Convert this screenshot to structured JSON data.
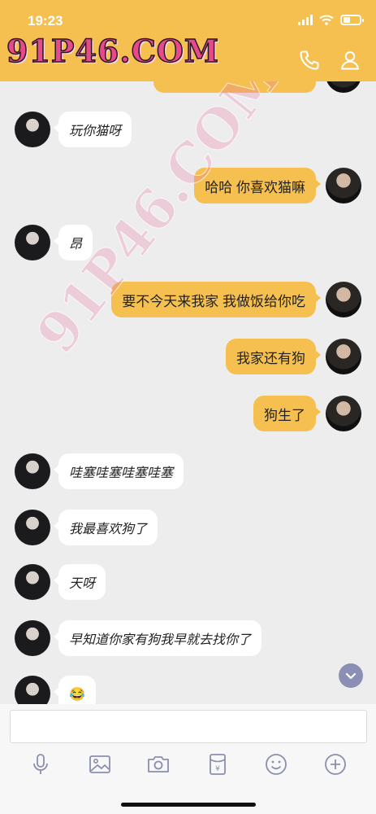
{
  "status": {
    "time": "19:23"
  },
  "header": {
    "brand": "91P46.COM"
  },
  "watermark": "91P46.COM",
  "messages": [
    {
      "side": "her",
      "text": "玩你猫呀"
    },
    {
      "side": "me",
      "text": "哈哈 你喜欢猫嘛"
    },
    {
      "side": "her",
      "text": "昂"
    },
    {
      "side": "me",
      "text": "要不今天来我家 我做饭给你吃"
    },
    {
      "side": "me",
      "text": "我家还有狗"
    },
    {
      "side": "me",
      "text": "狗生了"
    },
    {
      "side": "her",
      "text": "哇塞哇塞哇塞哇塞"
    },
    {
      "side": "her",
      "text": "我最喜欢狗了"
    },
    {
      "side": "her",
      "text": "天呀"
    },
    {
      "side": "her",
      "text": "早知道你家有狗我早就去找你了"
    },
    {
      "side": "her",
      "text": "😂"
    }
  ],
  "composer": {
    "value": "",
    "placeholder": ""
  },
  "toolbar": [
    "mic-icon",
    "image-icon",
    "camera-icon",
    "red-packet-icon",
    "emoji-icon",
    "plus-icon"
  ],
  "colors": {
    "accent": "#f5c04f",
    "background": "#ededed",
    "bubble_her": "#ffffff"
  }
}
